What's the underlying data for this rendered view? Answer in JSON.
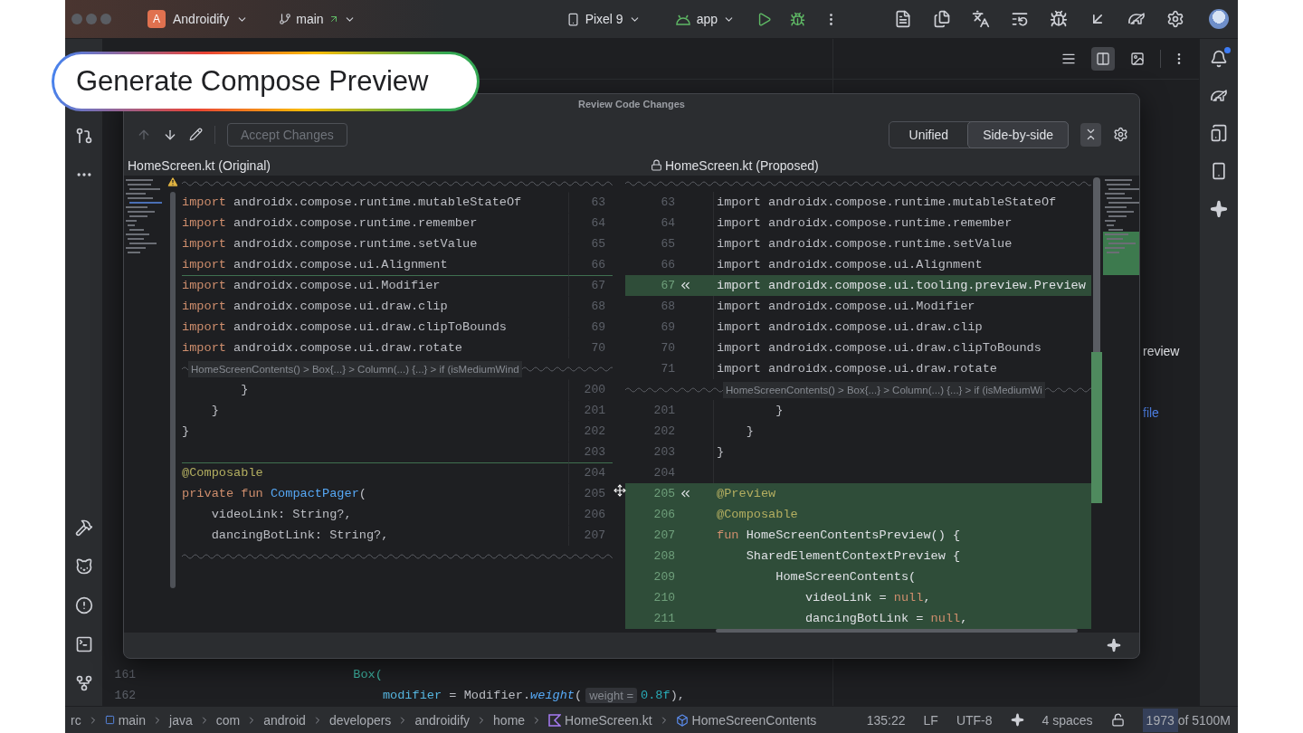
{
  "top_bar": {
    "project": {
      "badge": "A",
      "name": "Androidify"
    },
    "branch": "main",
    "device": "Pixel 9",
    "run_config": "app"
  },
  "callout": {
    "text": "Generate Compose Preview"
  },
  "editor_toolbar": {
    "view_modes": [
      {
        "kind": "code",
        "selected": false
      },
      {
        "kind": "split",
        "selected": true
      },
      {
        "kind": "design",
        "selected": false
      }
    ]
  },
  "editor": {
    "lines": [
      {
        "number": "161",
        "tokens": [
          {
            "text": "                           Box(",
            "kind": "call"
          }
        ]
      },
      {
        "number": "162",
        "tokens": [
          {
            "text": "                               modifier",
            "kind": "named_arg"
          },
          {
            "text": " = Modifier.",
            "kind": "plain"
          },
          {
            "text": "weight",
            "kind": "extension"
          },
          {
            "text": "(",
            "kind": "plain"
          },
          {
            "text": "weight =",
            "kind": "hint"
          },
          {
            "text": "0.8f",
            "kind": "number"
          },
          {
            "text": "),",
            "kind": "plain"
          }
        ]
      }
    ]
  },
  "right_panel": {
    "texts": [
      {
        "text": "review",
        "kind": "plain"
      },
      {
        "text": "file",
        "kind": "link"
      }
    ]
  },
  "dialog": {
    "title": "Review Code Changes",
    "toolbar": {
      "buttons": [
        {
          "kind": "up",
          "disabled": true
        },
        {
          "kind": "down",
          "disabled": false
        },
        {
          "kind": "edit",
          "disabled": false
        }
      ],
      "accept": {
        "label": "Accept Changes",
        "disabled": true
      }
    },
    "view_tabs": [
      {
        "label": "Unified",
        "selected": false
      },
      {
        "label": "Side-by-side",
        "selected": true
      }
    ],
    "original": {
      "title": "HomeScreen.kt (Original)",
      "rows": [
        {
          "kind": "fold"
        },
        {
          "kind": "code",
          "number": "63",
          "insertion": false,
          "tokens": [
            {
              "text": "import",
              "kind": "keyword"
            },
            {
              "text": " androidx.compose.runtime.mutableStateOf",
              "kind": "plain"
            }
          ]
        },
        {
          "kind": "code",
          "number": "64",
          "insertion": false,
          "tokens": [
            {
              "text": "import",
              "kind": "keyword"
            },
            {
              "text": " androidx.compose.runtime.remember",
              "kind": "plain"
            }
          ]
        },
        {
          "kind": "code",
          "number": "65",
          "insertion": false,
          "tokens": [
            {
              "text": "import",
              "kind": "keyword"
            },
            {
              "text": " androidx.compose.runtime.setValue",
              "kind": "plain"
            }
          ]
        },
        {
          "kind": "code",
          "number": "66",
          "insertion": false,
          "tokens": [
            {
              "text": "import",
              "kind": "keyword"
            },
            {
              "text": " androidx.compose.ui.Alignment",
              "kind": "plain"
            }
          ]
        },
        {
          "kind": "code",
          "number": "67",
          "insertion": true,
          "tokens": [
            {
              "text": "import",
              "kind": "keyword"
            },
            {
              "text": " androidx.compose.ui.Modifier",
              "kind": "plain"
            }
          ]
        },
        {
          "kind": "code",
          "number": "68",
          "insertion": false,
          "tokens": [
            {
              "text": "import",
              "kind": "keyword"
            },
            {
              "text": " androidx.compose.ui.draw.clip",
              "kind": "plain"
            }
          ]
        },
        {
          "kind": "code",
          "number": "69",
          "insertion": false,
          "tokens": [
            {
              "text": "import",
              "kind": "keyword"
            },
            {
              "text": " androidx.compose.ui.draw.clipToBounds",
              "kind": "plain"
            }
          ]
        },
        {
          "kind": "code",
          "number": "70",
          "insertion": false,
          "tokens": [
            {
              "text": "import",
              "kind": "keyword"
            },
            {
              "text": " androidx.compose.ui.draw.rotate",
              "kind": "plain"
            }
          ]
        },
        {
          "kind": "breadcrumb",
          "text": "HomeScreenContents() > Box{...} > Column(...) {...} > if (isMediumWind"
        },
        {
          "kind": "code",
          "number": "200",
          "insertion": false,
          "tokens": [
            {
              "text": "        }",
              "kind": "plain"
            }
          ]
        },
        {
          "kind": "code",
          "number": "201",
          "insertion": false,
          "tokens": [
            {
              "text": "    }",
              "kind": "plain"
            }
          ]
        },
        {
          "kind": "code",
          "number": "202",
          "insertion": false,
          "tokens": [
            {
              "text": "}",
              "kind": "plain"
            }
          ]
        },
        {
          "kind": "code",
          "number": "203",
          "insertion": false
        },
        {
          "kind": "code",
          "number": "204",
          "insertion": true,
          "tokens": [
            {
              "text": "@Composable",
              "kind": "annotation"
            }
          ]
        },
        {
          "kind": "code",
          "number": "205",
          "insertion": false,
          "tokens": [
            {
              "text": "private fun ",
              "kind": "keyword"
            },
            {
              "text": "CompactPager",
              "kind": "function"
            },
            {
              "text": "(",
              "kind": "plain"
            }
          ]
        },
        {
          "kind": "code",
          "number": "206",
          "insertion": false,
          "tokens": [
            {
              "text": "    videoLink: String?,",
              "kind": "plain"
            }
          ]
        },
        {
          "kind": "code",
          "number": "207",
          "insertion": false,
          "tokens": [
            {
              "text": "    dancingBotLink: String?,",
              "kind": "plain"
            }
          ]
        },
        {
          "kind": "fold"
        }
      ]
    },
    "proposed": {
      "title": "HomeScreen.kt (Proposed)",
      "rows": [
        {
          "kind": "fold"
        },
        {
          "kind": "code",
          "number": "63",
          "added": false,
          "revert": false,
          "tokens": [
            {
              "text": "import androidx.compose.runtime.mutableStateOf",
              "kind": "plain"
            }
          ]
        },
        {
          "kind": "code",
          "number": "64",
          "added": false,
          "revert": false,
          "tokens": [
            {
              "text": "import androidx.compose.runtime.remember",
              "kind": "plain"
            }
          ]
        },
        {
          "kind": "code",
          "number": "65",
          "added": false,
          "revert": false,
          "tokens": [
            {
              "text": "import androidx.compose.runtime.setValue",
              "kind": "plain"
            }
          ]
        },
        {
          "kind": "code",
          "number": "66",
          "added": false,
          "revert": false,
          "tokens": [
            {
              "text": "import androidx.compose.ui.Alignment",
              "kind": "plain"
            }
          ]
        },
        {
          "kind": "code",
          "number": "67",
          "added": true,
          "revert": true,
          "tokens": [
            {
              "text": "import androidx.compose.ui.tooling.preview.Preview",
              "kind": "plain"
            }
          ]
        },
        {
          "kind": "code",
          "number": "68",
          "added": false,
          "revert": false,
          "tokens": [
            {
              "text": "import androidx.compose.ui.Modifier",
              "kind": "plain"
            }
          ]
        },
        {
          "kind": "code",
          "number": "69",
          "added": false,
          "revert": false,
          "tokens": [
            {
              "text": "import androidx.compose.ui.draw.clip",
              "kind": "plain"
            }
          ]
        },
        {
          "kind": "code",
          "number": "70",
          "added": false,
          "revert": false,
          "tokens": [
            {
              "text": "import androidx.compose.ui.draw.clipToBounds",
              "kind": "plain"
            }
          ]
        },
        {
          "kind": "code",
          "number": "71",
          "added": false,
          "revert": false,
          "tokens": [
            {
              "text": "import androidx.compose.ui.draw.rotate",
              "kind": "plain"
            }
          ]
        },
        {
          "kind": "breadcrumb",
          "text": "HomeScreenContents() > Box{...} > Column(...) {...} > if (isMediumWi"
        },
        {
          "kind": "code",
          "number": "201",
          "added": false,
          "revert": false,
          "tokens": [
            {
              "text": "        }",
              "kind": "plain"
            }
          ]
        },
        {
          "kind": "code",
          "number": "202",
          "added": false,
          "revert": false,
          "tokens": [
            {
              "text": "    }",
              "kind": "plain"
            }
          ]
        },
        {
          "kind": "code",
          "number": "203",
          "added": false,
          "revert": false,
          "tokens": [
            {
              "text": "}",
              "kind": "plain"
            }
          ]
        },
        {
          "kind": "code",
          "number": "204",
          "added": false,
          "revert": false
        },
        {
          "kind": "code",
          "number": "205",
          "added": true,
          "revert": true,
          "tokens": [
            {
              "text": "@Preview",
              "kind": "annotation"
            }
          ]
        },
        {
          "kind": "code",
          "number": "206",
          "added": true,
          "revert": false,
          "tokens": [
            {
              "text": "@Composable",
              "kind": "annotation"
            }
          ]
        },
        {
          "kind": "code",
          "number": "207",
          "added": true,
          "revert": false,
          "tokens": [
            {
              "text": "fun ",
              "kind": "keyword"
            },
            {
              "text": "HomeScreenContentsPreview() {",
              "kind": "plain"
            }
          ]
        },
        {
          "kind": "code",
          "number": "208",
          "added": true,
          "revert": false,
          "tokens": [
            {
              "text": "    SharedElementContextPreview {",
              "kind": "plain"
            }
          ]
        },
        {
          "kind": "code",
          "number": "209",
          "added": true,
          "revert": false,
          "tokens": [
            {
              "text": "        HomeScreenContents(",
              "kind": "plain"
            }
          ]
        },
        {
          "kind": "code",
          "number": "210",
          "added": true,
          "revert": false,
          "tokens": [
            {
              "text": "            videoLink = ",
              "kind": "plain"
            },
            {
              "text": "null",
              "kind": "keyword"
            },
            {
              "text": ",",
              "kind": "plain"
            }
          ]
        },
        {
          "kind": "code",
          "number": "211",
          "added": true,
          "revert": false,
          "tokens": [
            {
              "text": "            dancingBotLink = ",
              "kind": "plain"
            },
            {
              "text": "null",
              "kind": "keyword"
            },
            {
              "text": ",",
              "kind": "plain"
            }
          ]
        }
      ]
    }
  },
  "status_bar": {
    "breadcrumbs": [
      {
        "label": "rc",
        "kind": "text"
      },
      {
        "label": "main",
        "kind": "module"
      },
      {
        "label": "java",
        "kind": "text"
      },
      {
        "label": "com",
        "kind": "text"
      },
      {
        "label": "android",
        "kind": "text"
      },
      {
        "label": "developers",
        "kind": "text"
      },
      {
        "label": "androidify",
        "kind": "text"
      },
      {
        "label": "home",
        "kind": "text"
      },
      {
        "label": "HomeScreen.kt",
        "kind": "kotlin_file"
      },
      {
        "label": "HomeScreenContents",
        "kind": "function"
      }
    ],
    "position": "135:22",
    "line_separator": "LF",
    "encoding": "UTF-8",
    "indent": "4 spaces",
    "memory": {
      "text": "1973 of 5100M",
      "level": 0.39
    }
  }
}
